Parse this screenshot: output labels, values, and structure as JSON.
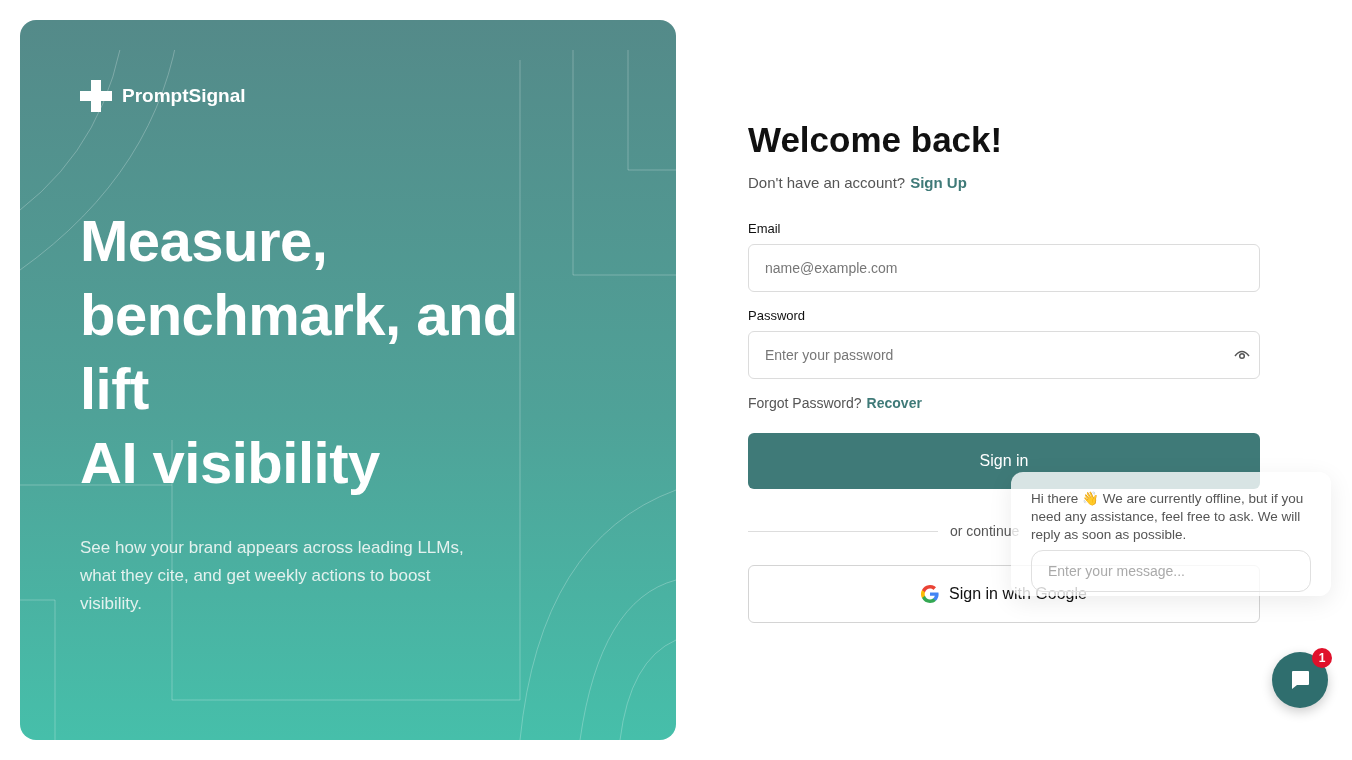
{
  "brand": {
    "name": "PromptSignal"
  },
  "hero": {
    "headline_lines": [
      "Measure,",
      "benchmark, and",
      "lift",
      "AI visibility"
    ],
    "subtitle": "See how your brand appears across leading LLMs, what they cite, and get weekly actions to boost visibility."
  },
  "form": {
    "title": "Welcome back!",
    "signup_prompt": "Don't have an account?",
    "signup_link": "Sign Up",
    "fields": [
      {
        "label": "Email",
        "placeholder": "name@example.com",
        "kind": "text"
      },
      {
        "label": "Password",
        "placeholder": "Enter your password",
        "kind": "password"
      }
    ],
    "forgot_prompt": "Forgot Password?",
    "recover_link": "Recover",
    "submit": "Sign in",
    "divider": "or continue",
    "google_button": "Sign in with Google"
  },
  "chat": {
    "message": "Hi there 👋 We are currently offline, but if you need any assistance, feel free to ask. We will reply as soon as possible.",
    "placeholder": "Enter your message...",
    "badge": "1"
  }
}
